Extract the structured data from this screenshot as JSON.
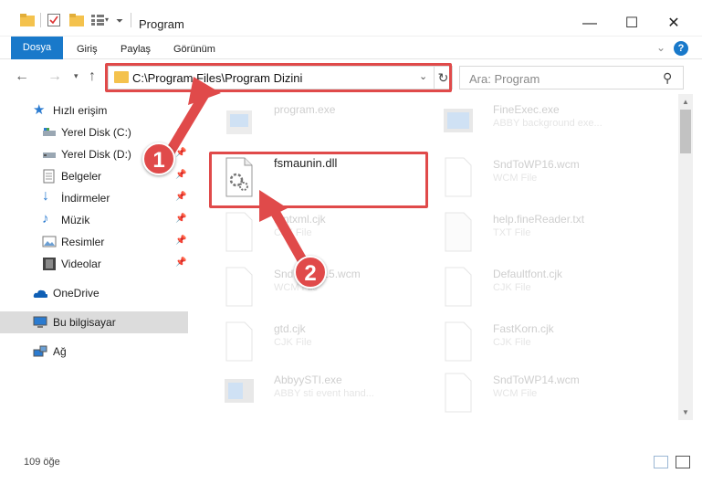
{
  "window": {
    "title": "Program",
    "minimize": "—",
    "maximize": "☐",
    "close": "✕"
  },
  "ribbon": {
    "tabs": [
      "Dosya",
      "Giriş",
      "Paylaş",
      "Görünüm"
    ]
  },
  "nav": {
    "address": "C:\\Program Files\\Program Dizini",
    "search_placeholder": "Ara: Program"
  },
  "sidebar": {
    "items": [
      {
        "label": "Hızlı erişim",
        "icon": "star-icon"
      },
      {
        "label": "Yerel Disk (C:)",
        "icon": "drive-icon"
      },
      {
        "label": "Yerel Disk (D:)",
        "icon": "drive-icon"
      },
      {
        "label": "Belgeler",
        "icon": "documents-icon"
      },
      {
        "label": "İndirmeler",
        "icon": "download-icon"
      },
      {
        "label": "Müzik",
        "icon": "music-icon"
      },
      {
        "label": "Resimler",
        "icon": "pictures-icon"
      },
      {
        "label": "Videolar",
        "icon": "videos-icon"
      },
      {
        "label": "OneDrive",
        "icon": "cloud-icon"
      },
      {
        "label": "Bu bilgisayar",
        "icon": "computer-icon"
      },
      {
        "label": "Ağ",
        "icon": "network-icon"
      }
    ]
  },
  "files": [
    {
      "name": "program.exe",
      "type": ""
    },
    {
      "name": "FineExec.exe",
      "type": "ABBY background exe..."
    },
    {
      "name": "fsmaunin.dll",
      "type": ""
    },
    {
      "name": "SndToWP16.wcm",
      "type": "WCM File"
    },
    {
      "name": "fontxml.cjk",
      "type": "CJK File"
    },
    {
      "name": "help.fineReader.txt",
      "type": "TXT File"
    },
    {
      "name": "SndToWP15.wcm",
      "type": "WCM File"
    },
    {
      "name": "Defaultfont.cjk",
      "type": "CJK File"
    },
    {
      "name": "gtd.cjk",
      "type": "CJK File"
    },
    {
      "name": "FastKorn.cjk",
      "type": "CJK File"
    },
    {
      "name": "AbbyySTI.exe",
      "type": "ABBY sti event hand..."
    },
    {
      "name": "SndToWP14.wcm",
      "type": "WCM File"
    }
  ],
  "status": {
    "count": "109 öğe"
  },
  "callouts": [
    "1",
    "2"
  ],
  "colors": {
    "accent": "#1979ca",
    "highlight": "#e04a4a",
    "folder": "#f4c24d"
  }
}
